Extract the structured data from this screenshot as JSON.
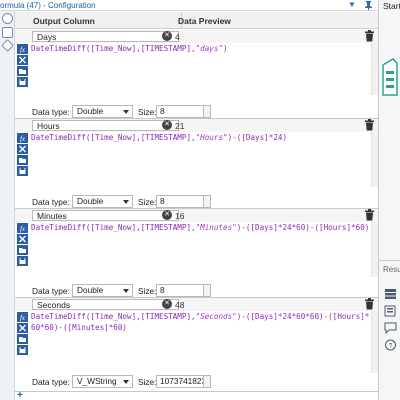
{
  "window": {
    "title": "ormula (47) - Configuration",
    "title_icons": [
      "chevron-down-icon",
      "pin-icon"
    ]
  },
  "columns": {
    "output": "Output Column",
    "preview": "Data Preview"
  },
  "fields": [
    {
      "name": "Days",
      "preview": "4",
      "expression": [
        {
          "t": "DateTimeDiff([Time_Now],[TIMESTAMP],",
          "s": false
        },
        {
          "t": "\"days\"",
          "s": true
        },
        {
          "t": ")",
          "s": false
        }
      ],
      "data_type_label": "Data type:",
      "data_type": "Double",
      "size_label": "Size:",
      "size": "8"
    },
    {
      "name": "Hours",
      "preview": "21",
      "expression": [
        {
          "t": "DateTimeDiff([Time_Now],[TIMESTAMP],",
          "s": false
        },
        {
          "t": "\"Hours\"",
          "s": true
        },
        {
          "t": ")-([Days]*24)",
          "s": false
        }
      ],
      "data_type_label": "Data type:",
      "data_type": "Double",
      "size_label": "Size:",
      "size": "8"
    },
    {
      "name": "Minutes",
      "preview": "16",
      "expression": [
        {
          "t": "DateTimeDiff([Time_Now],[TIMESTAMP],",
          "s": false
        },
        {
          "t": "\"Minutes\"",
          "s": true
        },
        {
          "t": ")-([Days]*24*60)-([Hours]*60)",
          "s": false
        }
      ],
      "data_type_label": "Data type:",
      "data_type": "Double",
      "size_label": "Size:",
      "size": "8"
    },
    {
      "name": "Seconds",
      "preview": "48",
      "expression": [
        {
          "t": "DateTimeDiff([Time_Now],[TIMESTAMP],",
          "s": false
        },
        {
          "t": "\"Seconds\"",
          "s": true
        },
        {
          "t": ")-([Days]*24*60*60)-([Hours]*60*60)-([Minutes]*60)",
          "s": false
        }
      ],
      "data_type_label": "Data type:",
      "data_type": "V_WString",
      "size_label": "Size:",
      "size": "1073741823"
    }
  ],
  "right_pane": {
    "start_label": "Start",
    "results_label": "Resu"
  },
  "add_label": "+",
  "colors": {
    "accent": "#1f5fa8",
    "expression": "#8b2bb8",
    "clear": "#444444"
  }
}
